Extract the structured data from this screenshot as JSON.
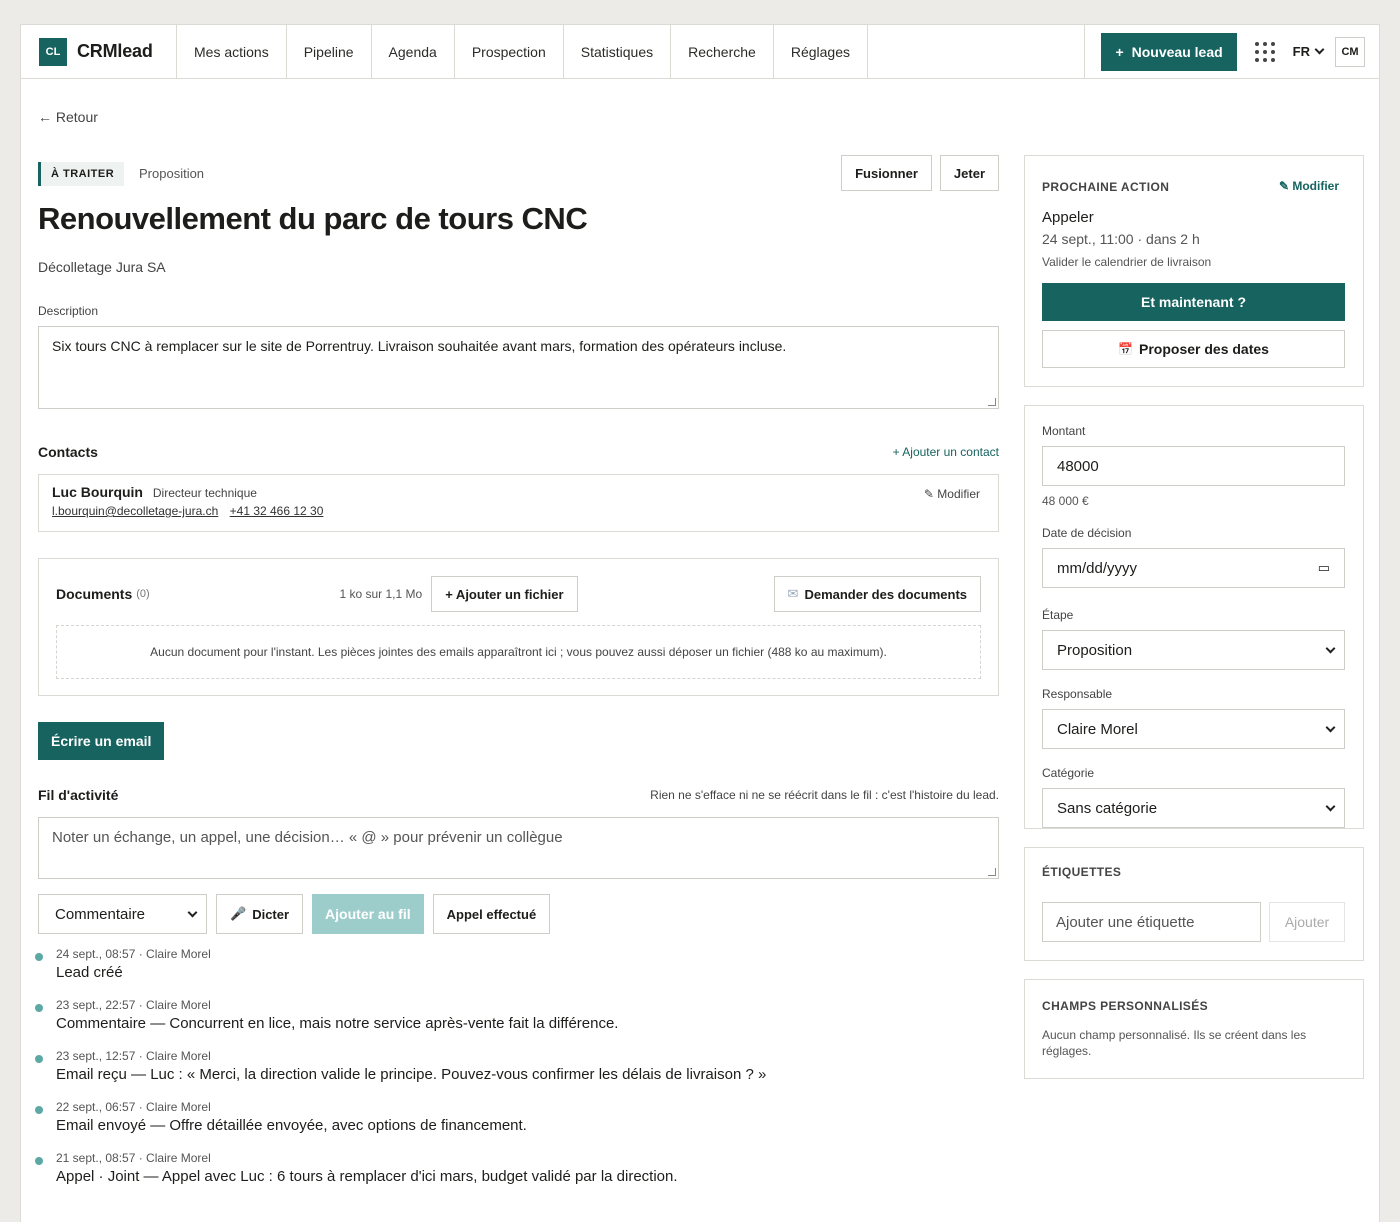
{
  "header": {
    "logo": "CL",
    "app_name": "CRMlead",
    "nav": [
      "Mes actions",
      "Pipeline",
      "Agenda",
      "Prospection",
      "Statistiques",
      "Recherche",
      "Réglages"
    ],
    "new_lead": "Nouveau lead",
    "lang": "FR",
    "avatar": "CM"
  },
  "back": "← Retour",
  "lead": {
    "status": "À TRAITER",
    "stage": "Proposition",
    "merge_btn": "Fusionner",
    "discard_btn": "Jeter",
    "title": "Renouvellement du parc de tours CNC",
    "company": "Décolletage Jura SA",
    "description_label": "Description",
    "description": "Six tours CNC à remplacer sur le site de Porrentruy. Livraison souhaitée avant mars, formation des opérateurs incluse."
  },
  "contacts": {
    "title": "Contacts",
    "add": "+ Ajouter un contact",
    "items": [
      {
        "name": "Luc Bourquin",
        "role": "Directeur technique",
        "email": "l.bourquin@decolletage-jura.ch",
        "phone": "+41 32 466 12 30",
        "edit": "✎ Modifier"
      }
    ]
  },
  "documents": {
    "title": "Documents",
    "count": "(0)",
    "size": "1 ko sur 1,1 Mo",
    "add": "+ Ajouter un fichier",
    "request": "Demander des documents",
    "empty": "Aucun document pour l'instant. Les pièces jointes des emails apparaîtront ici ; vous pouvez aussi déposer un fichier (488 ko au maximum)."
  },
  "write_email": "Écrire un email",
  "feed": {
    "title": "Fil d'activité",
    "note": "Rien ne s'efface ni ne se réécrit dans le fil : c'est l'histoire du lead.",
    "placeholder": "Noter un échange, un appel, une décision… « @ » pour prévenir un collègue",
    "type_select": "Commentaire",
    "dictate": "Dicter",
    "add": "Ajouter au fil",
    "call_done": "Appel effectué",
    "items": [
      {
        "meta": "24 sept., 08:57 · Claire Morel",
        "kind": "Lead créé",
        "text": ""
      },
      {
        "meta": "23 sept., 22:57 · Claire Morel",
        "kind": "Commentaire",
        "text": " — Concurrent en lice, mais notre service après-vente fait la différence."
      },
      {
        "meta": "23 sept., 12:57 · Claire Morel",
        "kind": "Email reçu",
        "text": " — Luc : « Merci, la direction valide le principe. Pouvez-vous confirmer les délais de livraison ? »"
      },
      {
        "meta": "22 sept., 06:57 · Claire Morel",
        "kind": "Email envoyé",
        "text": " — Offre détaillée envoyée, avec options de financement."
      },
      {
        "meta": "21 sept., 08:57 · Claire Morel",
        "kind": "Appel · Joint",
        "text": " — Appel avec Luc : 6 tours à remplacer d'ici mars, budget validé par la direction."
      }
    ]
  },
  "next_action": {
    "title": "PROCHAINE ACTION",
    "edit": "✎ Modifier",
    "type": "Appeler",
    "date": "24 sept., 11:00 · dans 2 h",
    "note": "Valider le calendrier de livraison",
    "now_btn": "Et maintenant ?",
    "propose_btn": "Proposer des dates"
  },
  "fields": {
    "amount_label": "Montant",
    "amount": "48000",
    "amount_hint": "48 000 €",
    "decision_label": "Date de décision",
    "decision_placeholder": "mm/dd/yyyy",
    "stage_label": "Étape",
    "stage": "Proposition",
    "owner_label": "Responsable",
    "owner": "Claire Morel",
    "category_label": "Catégorie",
    "category": "Sans catégorie"
  },
  "tags": {
    "title": "ÉTIQUETTES",
    "placeholder": "Ajouter une étiquette",
    "add": "Ajouter"
  },
  "custom": {
    "title": "CHAMPS PERSONNALISÉS",
    "text": "Aucun champ personnalisé. Ils se créent dans les réglages."
  },
  "colors": {
    "accent": "#16635f",
    "accent_disabled": "#9ccdcb",
    "timeline_dot": "#5ba8a5"
  }
}
